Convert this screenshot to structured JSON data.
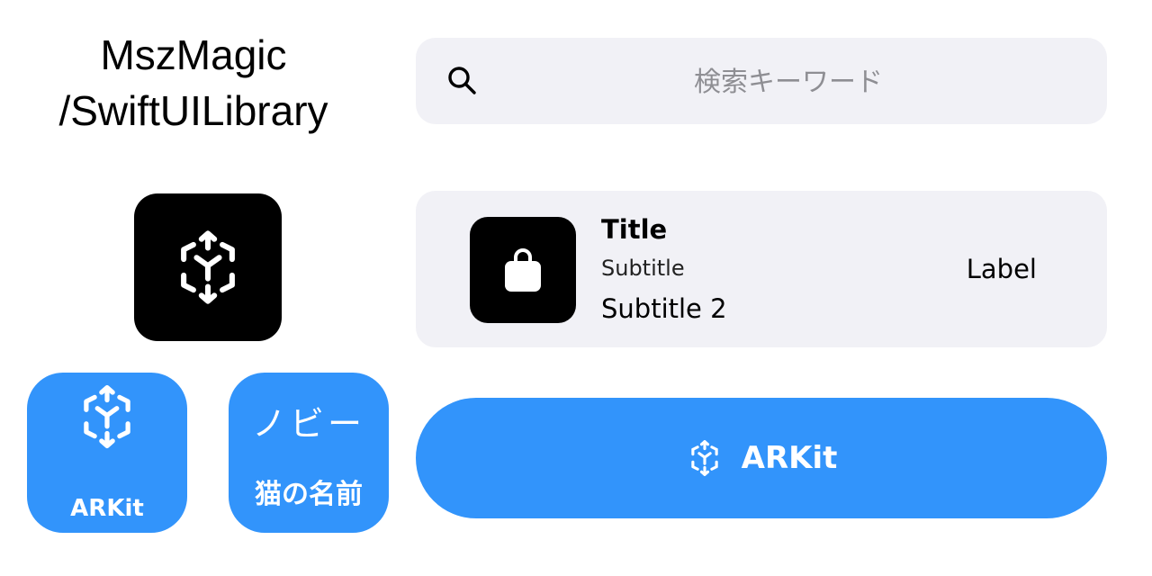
{
  "header": {
    "line1": "MszMagic",
    "line2": "/SwiftUILibrary"
  },
  "icons": {
    "ar_icon": "arkit-cube-icon",
    "bag_icon": "shopping-bag-icon",
    "search_icon": "magnifying-glass-icon"
  },
  "tiles": {
    "arkit_label": "ARKit",
    "noby_name": "ノビー",
    "noby_sub": "猫の名前"
  },
  "search": {
    "placeholder": "検索キーワード",
    "value": ""
  },
  "row": {
    "title": "Title",
    "subtitle": "Subtitle",
    "subtitle2": "Subtitle 2",
    "label": "Label"
  },
  "button": {
    "label": "ARKit"
  },
  "colors": {
    "accent": "#3294fb",
    "card_bg": "#f1f1f6",
    "dark_tile": "#000000",
    "placeholder": "#8e8e93"
  }
}
